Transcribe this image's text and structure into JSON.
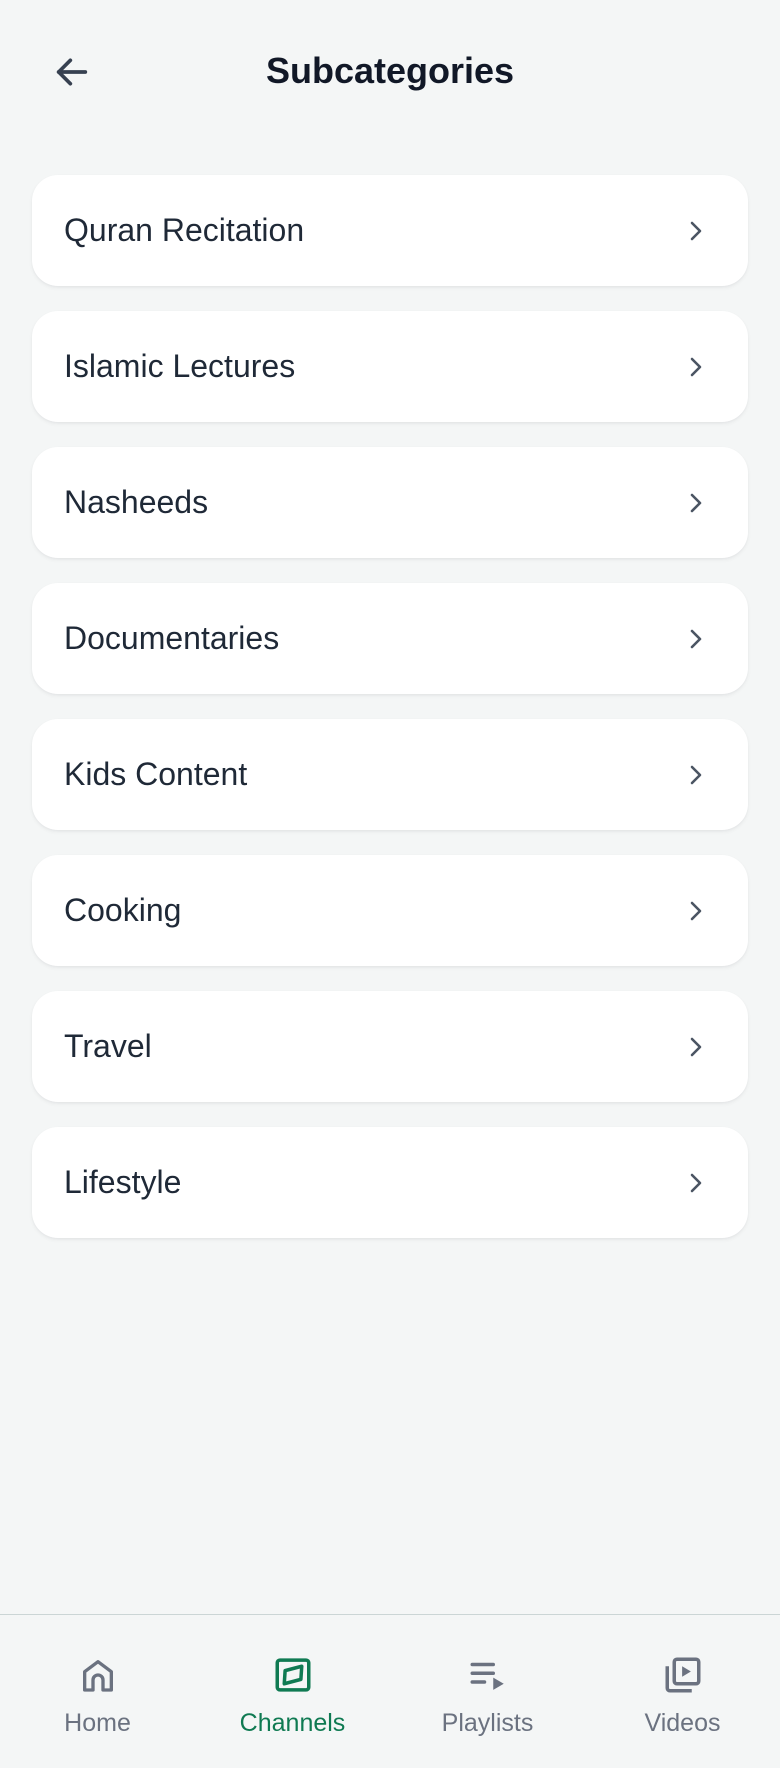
{
  "header": {
    "title": "Subcategories",
    "back_icon": "arrow-left-icon"
  },
  "subcategories": [
    {
      "label": "Quran Recitation",
      "icon": "chevron-right-icon"
    },
    {
      "label": "Islamic Lectures",
      "icon": "chevron-right-icon"
    },
    {
      "label": "Nasheeds",
      "icon": "chevron-right-icon"
    },
    {
      "label": "Documentaries",
      "icon": "chevron-right-icon"
    },
    {
      "label": "Kids Content",
      "icon": "chevron-right-icon"
    },
    {
      "label": "Cooking",
      "icon": "chevron-right-icon"
    },
    {
      "label": "Travel",
      "icon": "chevron-right-icon"
    },
    {
      "label": "Lifestyle",
      "icon": "chevron-right-icon"
    }
  ],
  "bottom_nav": {
    "active": "Channels",
    "items": [
      {
        "label": "Home",
        "icon": "home-icon"
      },
      {
        "label": "Channels",
        "icon": "channels-icon"
      },
      {
        "label": "Playlists",
        "icon": "playlist-icon"
      },
      {
        "label": "Videos",
        "icon": "video-library-icon"
      }
    ]
  },
  "colors": {
    "background": "#f4f6f6",
    "card": "#ffffff",
    "text": "#1f2937",
    "muted": "#6b7280",
    "accent": "#0f7a52"
  }
}
